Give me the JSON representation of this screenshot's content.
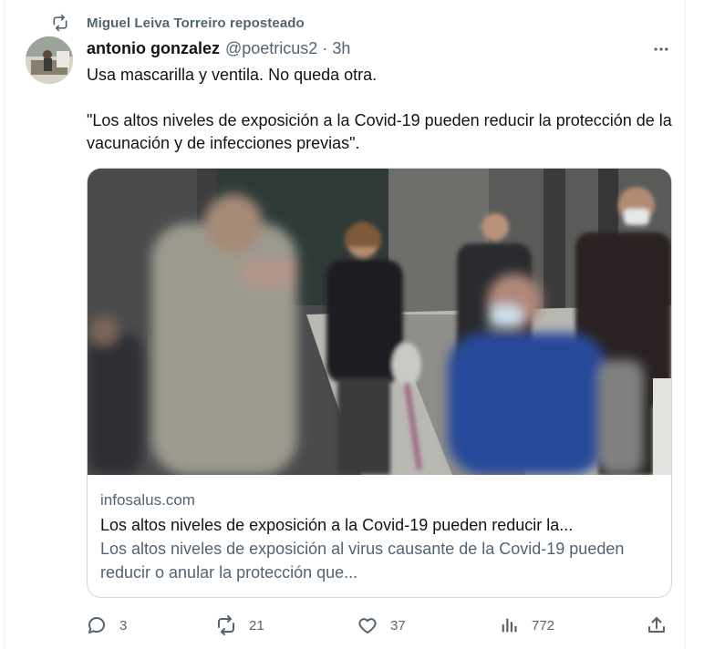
{
  "repost": {
    "icon": "repost-icon",
    "label": "Miguel Leiva Torreiro reposteado"
  },
  "author": {
    "name": "antonio gonzalez",
    "handle": "@poetricus2",
    "separator": "·",
    "time": "3h",
    "avatar_icon": "avatar"
  },
  "more_icon": "more-icon",
  "tweet": {
    "line1": "Usa mascarilla y ventila. No queda otra.",
    "line2": "\"Los altos niveles de exposición a la Covid-19 pueden reducir la protección de la vacunación y de infecciones previas\"."
  },
  "link_card": {
    "image_icon": "photo",
    "domain": "infosalus.com",
    "title": "Los altos niveles de exposición a la Covid-19 pueden reducir la...",
    "description": "Los altos niveles de exposición al virus causante de la Covid-19 pueden reducir o anular la protección que..."
  },
  "actions": {
    "reply": {
      "icon": "reply-icon",
      "count": "3"
    },
    "repost": {
      "icon": "repost-icon",
      "count": "21"
    },
    "like": {
      "icon": "heart-icon",
      "count": "37"
    },
    "views": {
      "icon": "views-icon",
      "count": "772"
    },
    "share": {
      "icon": "share-icon"
    }
  },
  "colors": {
    "text": "#0f1419",
    "secondary": "#536471",
    "border": "#cfd9de"
  }
}
